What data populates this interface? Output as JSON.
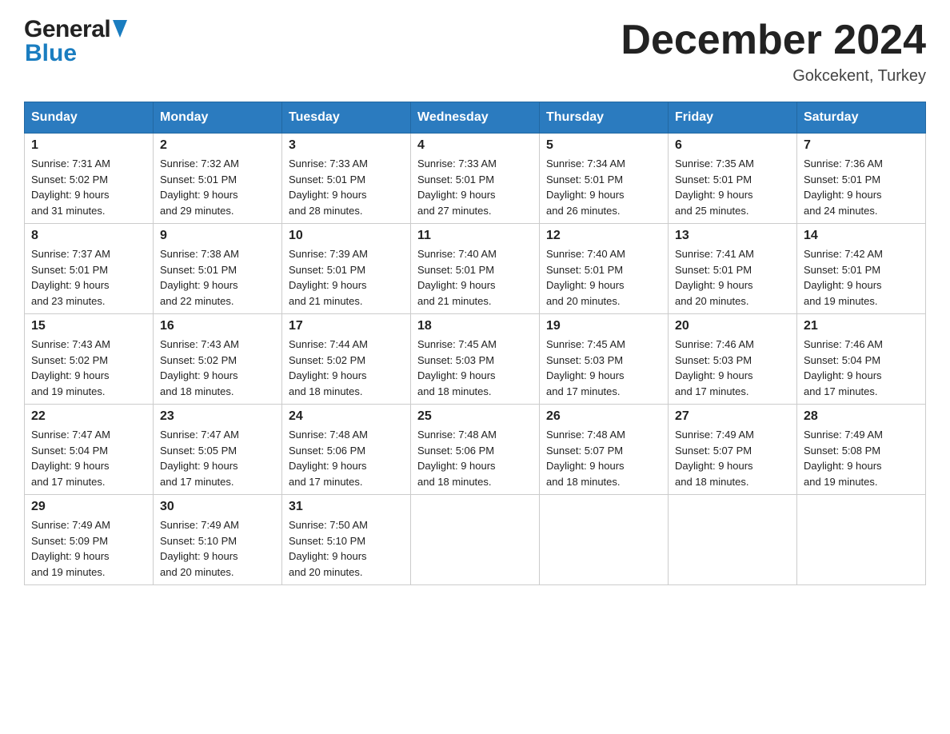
{
  "header": {
    "title": "December 2024",
    "location": "Gokcekent, Turkey"
  },
  "logo": {
    "general": "General",
    "blue": "Blue"
  },
  "days_of_week": [
    "Sunday",
    "Monday",
    "Tuesday",
    "Wednesday",
    "Thursday",
    "Friday",
    "Saturday"
  ],
  "weeks": [
    [
      {
        "day": "1",
        "sunrise": "7:31 AM",
        "sunset": "5:02 PM",
        "daylight": "9 hours and 31 minutes."
      },
      {
        "day": "2",
        "sunrise": "7:32 AM",
        "sunset": "5:01 PM",
        "daylight": "9 hours and 29 minutes."
      },
      {
        "day": "3",
        "sunrise": "7:33 AM",
        "sunset": "5:01 PM",
        "daylight": "9 hours and 28 minutes."
      },
      {
        "day": "4",
        "sunrise": "7:33 AM",
        "sunset": "5:01 PM",
        "daylight": "9 hours and 27 minutes."
      },
      {
        "day": "5",
        "sunrise": "7:34 AM",
        "sunset": "5:01 PM",
        "daylight": "9 hours and 26 minutes."
      },
      {
        "day": "6",
        "sunrise": "7:35 AM",
        "sunset": "5:01 PM",
        "daylight": "9 hours and 25 minutes."
      },
      {
        "day": "7",
        "sunrise": "7:36 AM",
        "sunset": "5:01 PM",
        "daylight": "9 hours and 24 minutes."
      }
    ],
    [
      {
        "day": "8",
        "sunrise": "7:37 AM",
        "sunset": "5:01 PM",
        "daylight": "9 hours and 23 minutes."
      },
      {
        "day": "9",
        "sunrise": "7:38 AM",
        "sunset": "5:01 PM",
        "daylight": "9 hours and 22 minutes."
      },
      {
        "day": "10",
        "sunrise": "7:39 AM",
        "sunset": "5:01 PM",
        "daylight": "9 hours and 21 minutes."
      },
      {
        "day": "11",
        "sunrise": "7:40 AM",
        "sunset": "5:01 PM",
        "daylight": "9 hours and 21 minutes."
      },
      {
        "day": "12",
        "sunrise": "7:40 AM",
        "sunset": "5:01 PM",
        "daylight": "9 hours and 20 minutes."
      },
      {
        "day": "13",
        "sunrise": "7:41 AM",
        "sunset": "5:01 PM",
        "daylight": "9 hours and 20 minutes."
      },
      {
        "day": "14",
        "sunrise": "7:42 AM",
        "sunset": "5:01 PM",
        "daylight": "9 hours and 19 minutes."
      }
    ],
    [
      {
        "day": "15",
        "sunrise": "7:43 AM",
        "sunset": "5:02 PM",
        "daylight": "9 hours and 19 minutes."
      },
      {
        "day": "16",
        "sunrise": "7:43 AM",
        "sunset": "5:02 PM",
        "daylight": "9 hours and 18 minutes."
      },
      {
        "day": "17",
        "sunrise": "7:44 AM",
        "sunset": "5:02 PM",
        "daylight": "9 hours and 18 minutes."
      },
      {
        "day": "18",
        "sunrise": "7:45 AM",
        "sunset": "5:03 PM",
        "daylight": "9 hours and 18 minutes."
      },
      {
        "day": "19",
        "sunrise": "7:45 AM",
        "sunset": "5:03 PM",
        "daylight": "9 hours and 17 minutes."
      },
      {
        "day": "20",
        "sunrise": "7:46 AM",
        "sunset": "5:03 PM",
        "daylight": "9 hours and 17 minutes."
      },
      {
        "day": "21",
        "sunrise": "7:46 AM",
        "sunset": "5:04 PM",
        "daylight": "9 hours and 17 minutes."
      }
    ],
    [
      {
        "day": "22",
        "sunrise": "7:47 AM",
        "sunset": "5:04 PM",
        "daylight": "9 hours and 17 minutes."
      },
      {
        "day": "23",
        "sunrise": "7:47 AM",
        "sunset": "5:05 PM",
        "daylight": "9 hours and 17 minutes."
      },
      {
        "day": "24",
        "sunrise": "7:48 AM",
        "sunset": "5:06 PM",
        "daylight": "9 hours and 17 minutes."
      },
      {
        "day": "25",
        "sunrise": "7:48 AM",
        "sunset": "5:06 PM",
        "daylight": "9 hours and 18 minutes."
      },
      {
        "day": "26",
        "sunrise": "7:48 AM",
        "sunset": "5:07 PM",
        "daylight": "9 hours and 18 minutes."
      },
      {
        "day": "27",
        "sunrise": "7:49 AM",
        "sunset": "5:07 PM",
        "daylight": "9 hours and 18 minutes."
      },
      {
        "day": "28",
        "sunrise": "7:49 AM",
        "sunset": "5:08 PM",
        "daylight": "9 hours and 19 minutes."
      }
    ],
    [
      {
        "day": "29",
        "sunrise": "7:49 AM",
        "sunset": "5:09 PM",
        "daylight": "9 hours and 19 minutes."
      },
      {
        "day": "30",
        "sunrise": "7:49 AM",
        "sunset": "5:10 PM",
        "daylight": "9 hours and 20 minutes."
      },
      {
        "day": "31",
        "sunrise": "7:50 AM",
        "sunset": "5:10 PM",
        "daylight": "9 hours and 20 minutes."
      },
      null,
      null,
      null,
      null
    ]
  ]
}
